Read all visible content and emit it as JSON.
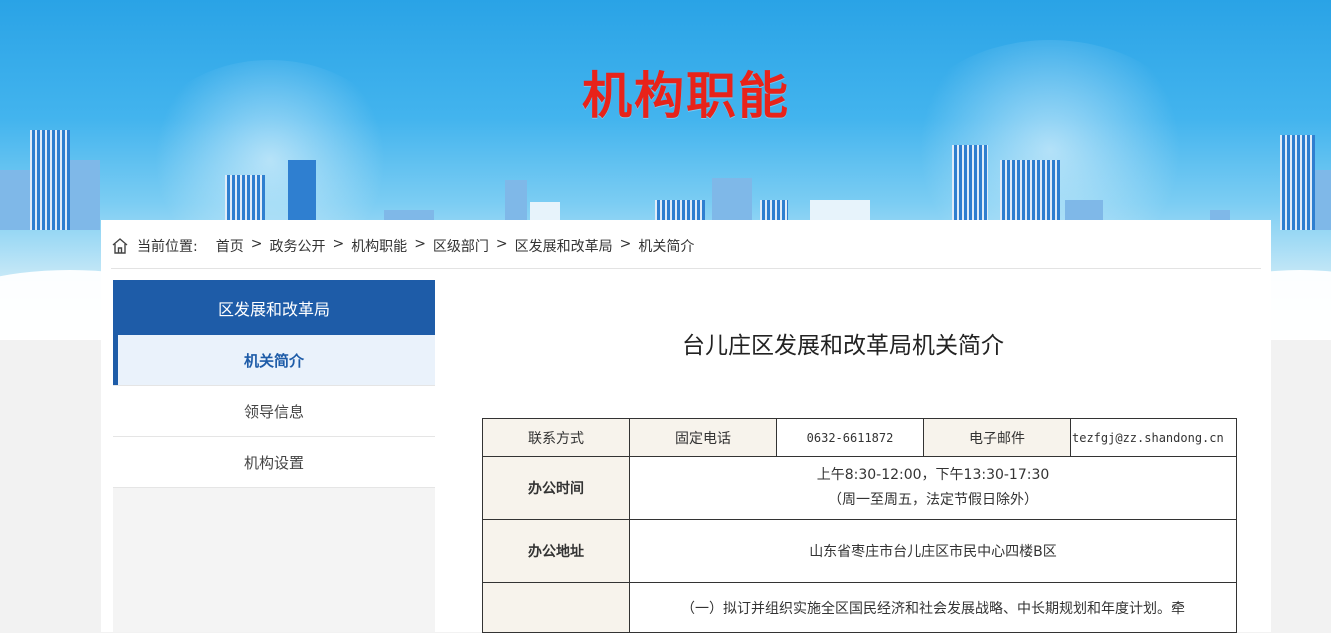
{
  "banner": {
    "title": "机构职能"
  },
  "breadcrumb": {
    "label": "当前位置:",
    "items": [
      "首页",
      "政务公开",
      "机构职能",
      "区级部门",
      "区发展和改革局",
      "机关简介"
    ],
    "separator": ">"
  },
  "sidebar": {
    "header": "区发展和改革局",
    "items": [
      {
        "label": "机关简介",
        "active": true
      },
      {
        "label": "领导信息",
        "active": false
      },
      {
        "label": "机构设置",
        "active": false
      }
    ]
  },
  "article": {
    "title": "台儿庄区发展和改革局机关简介"
  },
  "info_table": {
    "contact_label": "联系方式",
    "phone_label": "固定电话",
    "phone_value": "0632-6611872",
    "email_label": "电子邮件",
    "email_value": "tezfgj@zz.shandong.cn",
    "hours_label": "办公时间",
    "hours_line1": "上午8:30-12:00，下午13:30-17:30",
    "hours_line2": "（周一至周五，法定节假日除外）",
    "address_label": "办公地址",
    "address_value": "山东省枣庄市台儿庄区市民中心四楼B区",
    "duty_text": "（一）拟订并组织实施全区国民经济和社会发展战略、中长期规划和年度计划。牵"
  },
  "colors": {
    "title_red": "#e8231a",
    "nav_blue": "#1e5ca8",
    "sky_blue": "#2aa3e6",
    "table_head_bg": "#f7f3ec"
  }
}
